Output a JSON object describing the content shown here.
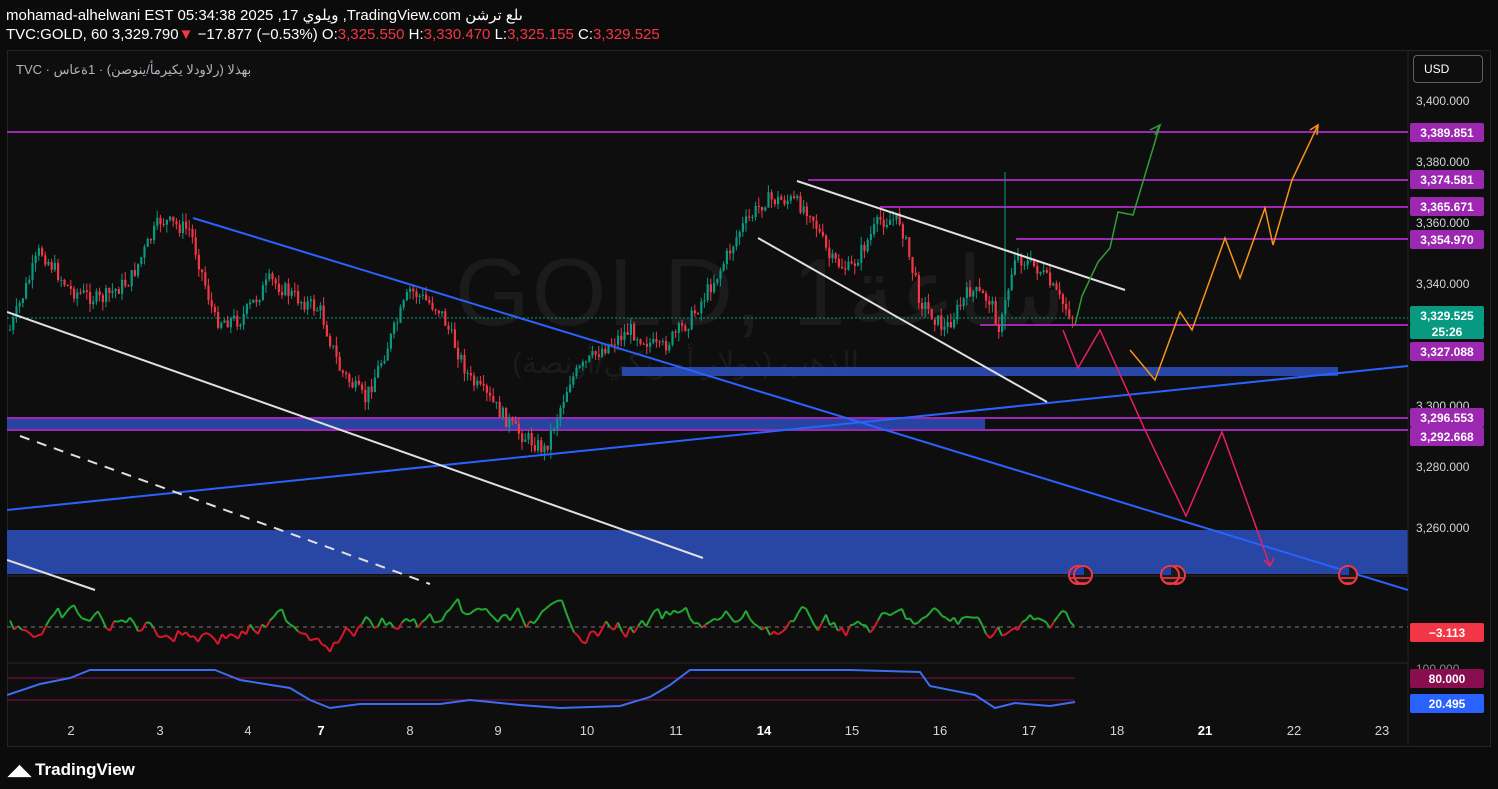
{
  "header": {
    "line1": "mohamad-alhelwani EST 05:34:38 2025 ,17 ويلوي ,TradingView.com ىلع ترشن",
    "symbol": "TVC:GOLD, 60",
    "last": "3,329.790",
    "change_arrow": "▼",
    "change": "−17.877 (−0.53%)",
    "o_label": "O:",
    "o_val": "3,325.550",
    "h_label": "H:",
    "h_val": "3,330.470",
    "l_label": "L:",
    "l_val": "3,325.155",
    "c_label": "C:",
    "c_val": "3,329.525"
  },
  "legend": "TVC · بهذلا (رلاودلا يكيرمأ/ينوصن) · 1ةعاس",
  "currency_button": "USD",
  "watermark": {
    "main": "GOLD, 1ساعة",
    "sub": "الذهب (دولار أمريكي/أونصة)"
  },
  "price_axis": [
    "3,400.000",
    "3,380.000",
    "3,360.000",
    "3,340.000",
    "3,300.000",
    "3,280.000",
    "3,260.000"
  ],
  "price_tags": [
    {
      "value": "3,389.851",
      "kind": "purple"
    },
    {
      "value": "3,374.581",
      "kind": "purple"
    },
    {
      "value": "3,365.671",
      "kind": "purple"
    },
    {
      "value": "3,354.970",
      "kind": "purple"
    },
    {
      "value": "3,329.525",
      "kind": "green"
    },
    {
      "value": "3,327.088",
      "kind": "purple"
    },
    {
      "value": "3,296.553",
      "kind": "purple"
    },
    {
      "value": "3,292.668",
      "kind": "purple"
    }
  ],
  "countdown": "25:26",
  "oscillator": {
    "value": "−3.113"
  },
  "rsi": {
    "upper": "80.000",
    "value": "20.495",
    "top": "100.000"
  },
  "time_axis": [
    {
      "label": "2",
      "bold": false
    },
    {
      "label": "3",
      "bold": false
    },
    {
      "label": "4",
      "bold": false
    },
    {
      "label": "7",
      "bold": true
    },
    {
      "label": "8",
      "bold": false
    },
    {
      "label": "9",
      "bold": false
    },
    {
      "label": "10",
      "bold": false
    },
    {
      "label": "11",
      "bold": false
    },
    {
      "label": "14",
      "bold": true
    },
    {
      "label": "15",
      "bold": false
    },
    {
      "label": "16",
      "bold": false
    },
    {
      "label": "17",
      "bold": false
    },
    {
      "label": "18",
      "bold": false
    },
    {
      "label": "21",
      "bold": true
    },
    {
      "label": "22",
      "bold": false
    },
    {
      "label": "23",
      "bold": false
    }
  ],
  "brand": "TradingView",
  "colors": {
    "up": "#089981",
    "down": "#f23645",
    "level": "#9c27b0",
    "zone": "#2a4bb0",
    "trend_blue": "#2962ff"
  }
}
